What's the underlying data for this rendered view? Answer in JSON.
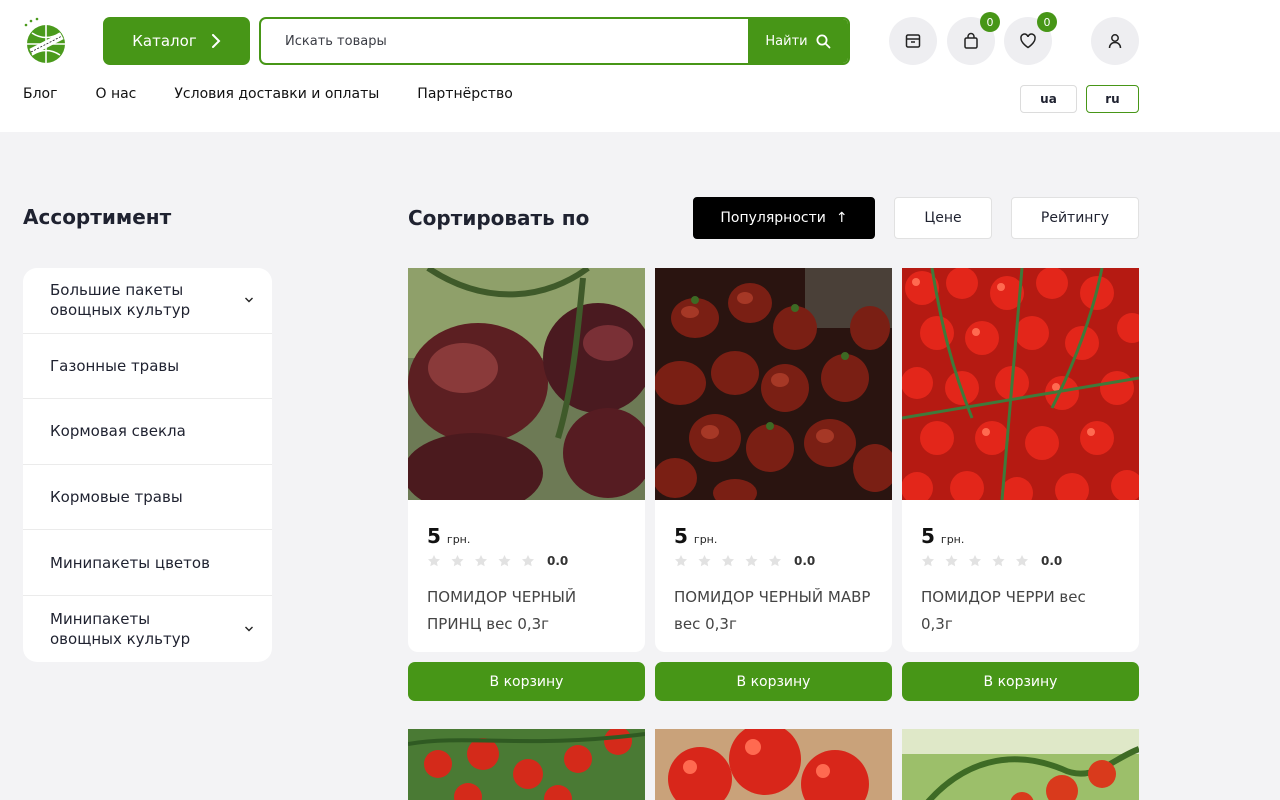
{
  "header": {
    "catalog_label": "Каталог",
    "search": {
      "placeholder": "Искать товары",
      "button_label": "Найти"
    },
    "cart_count": "0",
    "wishlist_count": "0",
    "nav": [
      "Блог",
      "О нас",
      "Условия доставки и оплаты",
      "Партнёрство"
    ],
    "langs": [
      "ua",
      "ru"
    ],
    "active_lang": "ru",
    "accent_color": "#479617"
  },
  "sidebar": {
    "title": "Ассортимент",
    "categories": [
      {
        "label": "Большие пакеты овощных культур",
        "expandable": true
      },
      {
        "label": "Газонные травы",
        "expandable": false
      },
      {
        "label": "Кормовая свекла",
        "expandable": false
      },
      {
        "label": "Кормовые травы",
        "expandable": false
      },
      {
        "label": "Минипакеты цветов",
        "expandable": false
      },
      {
        "label": "Минипакеты овощных культур",
        "expandable": true
      }
    ]
  },
  "sort": {
    "title": "Сортировать по",
    "options": [
      "Популярности",
      "Цене",
      "Рейтингу"
    ],
    "active": "Популярности",
    "arrow": "↑"
  },
  "products": [
    {
      "price": "5",
      "currency": "грн.",
      "rating": "0.0",
      "name": "ПОМИДОР ЧЕРНЫЙ ПРИНЦ вес 0,3г",
      "cart_label": "В корзину"
    },
    {
      "price": "5",
      "currency": "грн.",
      "rating": "0.0",
      "name": "ПОМИДОР ЧЕРНЫЙ МАВР вес 0,3г",
      "cart_label": "В корзину"
    },
    {
      "price": "5",
      "currency": "грн.",
      "rating": "0.0",
      "name": "ПОМИДОР ЧЕРРИ вес 0,3г",
      "cart_label": "В корзину"
    }
  ]
}
